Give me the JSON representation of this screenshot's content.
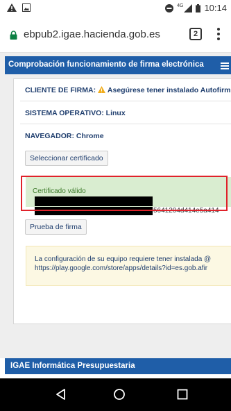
{
  "status": {
    "time": "10:14",
    "network": "4G"
  },
  "browser": {
    "url": "ebpub2.igae.hacienda.gob.es",
    "tab_count": "2"
  },
  "header": {
    "title": "Comprobación funcionamiento de firma electrónica"
  },
  "info": {
    "client_label": "CLIENTE DE FIRMA:",
    "client_value": " Asegúrese tener instalado Autofirm",
    "os_label": "SISTEMA OPERATIVO:",
    "os_value": " Linux",
    "browser_label": "NAVEGADOR:",
    "browser_value": " Chrome"
  },
  "buttons": {
    "select_cert": "Seleccionar certificado",
    "test_sign": "Prueba de firma"
  },
  "certificate": {
    "status": "Certificado válido",
    "partial_value": "5641204d414e5a414"
  },
  "notice": {
    "line1": "La configuración de su equipo requiere tener instalada @",
    "line2": "https://play.google.com/store/apps/details?id=es.gob.afir"
  },
  "footer": {
    "title": "IGAE Informática Presupuestaria"
  },
  "colors": {
    "header_blue": "#1f5ea8",
    "valid_green": "#d9edd0",
    "highlight_red": "#e0222a",
    "notice_yellow": "#fcf8e3"
  }
}
